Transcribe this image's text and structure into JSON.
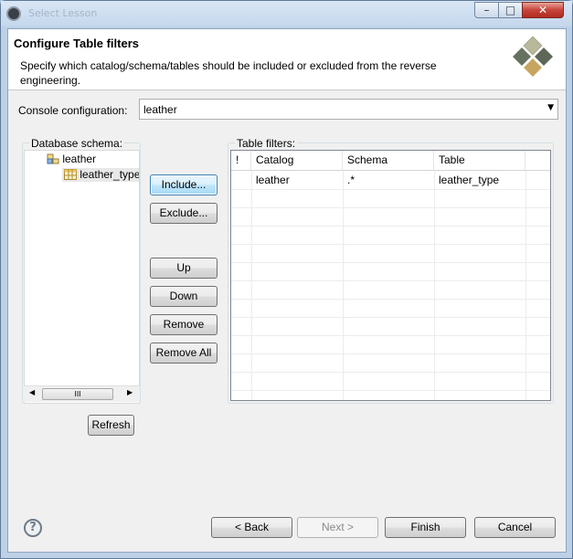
{
  "window": {
    "title": "Select Lesson"
  },
  "header": {
    "title": "Configure Table filters",
    "description": "Specify which catalog/schema/tables should be included or excluded from the reverse engineering."
  },
  "console": {
    "label": "Console configuration:",
    "value": "leather"
  },
  "schema": {
    "label": "Database schema:",
    "nodes": [
      {
        "label": "leather"
      },
      {
        "label": "leather_type"
      }
    ],
    "scroll_glyph": "III"
  },
  "actions": {
    "include": "Include...",
    "exclude": "Exclude...",
    "up": "Up",
    "down": "Down",
    "remove": "Remove",
    "remove_all": "Remove All",
    "refresh": "Refresh"
  },
  "filters": {
    "label": "Table filters:",
    "columns": [
      "!",
      "Catalog",
      "Schema",
      "Table"
    ],
    "rows": [
      {
        "flag": "",
        "catalog": "leather",
        "schema": ".*",
        "table": "leather_type"
      }
    ]
  },
  "footer": {
    "back": "< Back",
    "next": "Next >",
    "finish": "Finish",
    "cancel": "Cancel",
    "help": "?"
  },
  "icons": {
    "logo": "hibernate-cube-icon",
    "schema": "database-schema-icon",
    "table": "table-icon"
  }
}
